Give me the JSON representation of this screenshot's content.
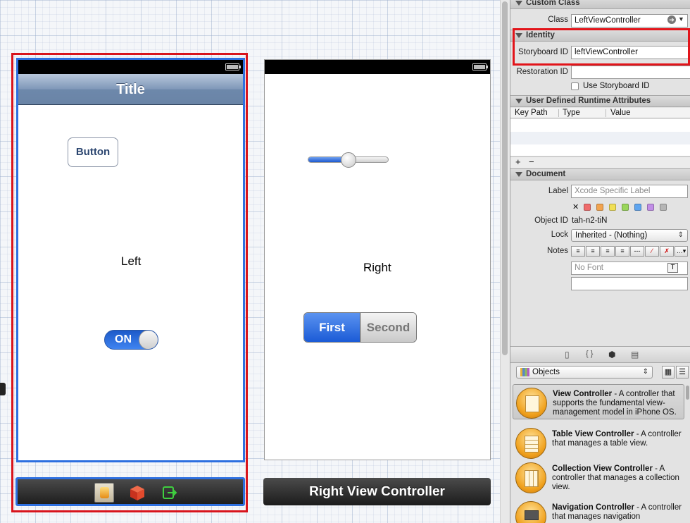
{
  "canvas": {
    "left_scene": {
      "nav_title": "Title",
      "button_label": "Button",
      "label_text": "Left",
      "switch_text": "ON",
      "dock_icons": [
        "view-controller-icon",
        "first-responder-icon",
        "exit-icon"
      ]
    },
    "right_scene": {
      "label_text": "Right",
      "slider_value": 0.5,
      "segments": [
        "First",
        "Second"
      ],
      "selected_segment": "First",
      "dock_title": "Right View Controller"
    }
  },
  "inspector": {
    "custom_class": {
      "header": "Custom Class",
      "class_label": "Class",
      "class_value": "LeftViewController"
    },
    "identity": {
      "header": "Identity",
      "storyboard_id_label": "Storyboard ID",
      "storyboard_id_value": "leftViewController",
      "restoration_id_label": "Restoration ID",
      "restoration_id_value": "",
      "use_storyboard_id_label": "Use Storyboard ID"
    },
    "runtime_attributes": {
      "header": "User Defined Runtime Attributes",
      "columns": [
        "Key Path",
        "Type",
        "Value"
      ],
      "add_label": "+",
      "remove_label": "−"
    },
    "document": {
      "header": "Document",
      "label_label": "Label",
      "label_placeholder": "Xcode Specific Label",
      "clear_label": "✕",
      "swatch_colors": [
        "#ef6b6b",
        "#f2a34e",
        "#f0df55",
        "#9ad65a",
        "#5fa5ef",
        "#c18ee6",
        "#b5b5b5"
      ],
      "object_id_label": "Object ID",
      "object_id_value": "tah-n2-tiN",
      "lock_label": "Lock",
      "lock_value": "Inherited - (Nothing)",
      "notes_label": "Notes",
      "font_placeholder": "No Font",
      "font_button": "T"
    },
    "library_tabs": [
      "file-template-icon",
      "code-snippet-icon",
      "object-library-icon",
      "media-library-icon"
    ],
    "library": {
      "popup_value": "Objects",
      "items": [
        {
          "title": "View Controller",
          "desc": " - A controller that supports the fundamental view-management model in iPhone OS."
        },
        {
          "title": "Table View Controller",
          "desc": " - A controller that manages a table view."
        },
        {
          "title": "Collection View Controller",
          "desc": " - A controller that manages a collection view."
        },
        {
          "title": "Navigation Controller",
          "desc": " - A controller that manages navigation"
        }
      ]
    }
  }
}
